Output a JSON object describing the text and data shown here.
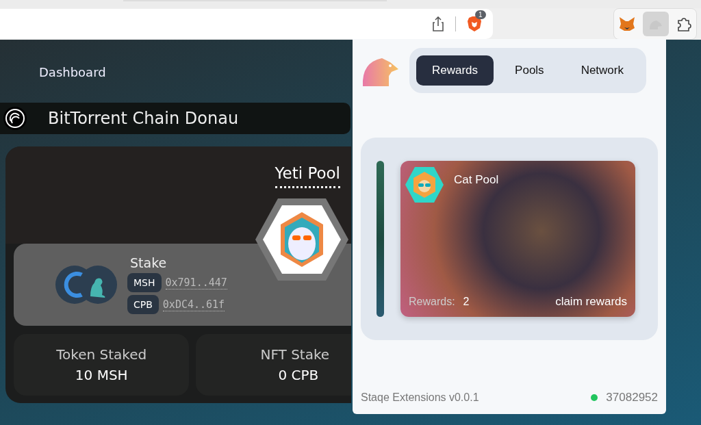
{
  "browser": {
    "extension_badge": "1"
  },
  "page": {
    "nav": "Dashboard",
    "chain": "BitTorrent Chain Donau",
    "pool": {
      "title": "Yeti Pool",
      "stake_label": "Stake",
      "tokens": [
        {
          "symbol": "MSH",
          "address": "0x791..447"
        },
        {
          "symbol": "CPB",
          "address": "0xDC4..61f"
        }
      ],
      "stats": [
        {
          "label": "Token Staked",
          "value": "10 MSH"
        },
        {
          "label": "NFT Stake",
          "value": "0 CPB"
        }
      ]
    }
  },
  "popup": {
    "tabs": [
      {
        "label": "Rewards",
        "selected": true
      },
      {
        "label": "Pools",
        "selected": false
      },
      {
        "label": "Network",
        "selected": false
      }
    ],
    "cards": [
      {
        "title": "Cat Pool",
        "rewards_label": "Rewards:",
        "rewards": "2",
        "action": "claim rewards"
      }
    ],
    "footer": {
      "version": "Staqe Extensions v0.0.1",
      "connected": true,
      "block": "37082952"
    }
  }
}
